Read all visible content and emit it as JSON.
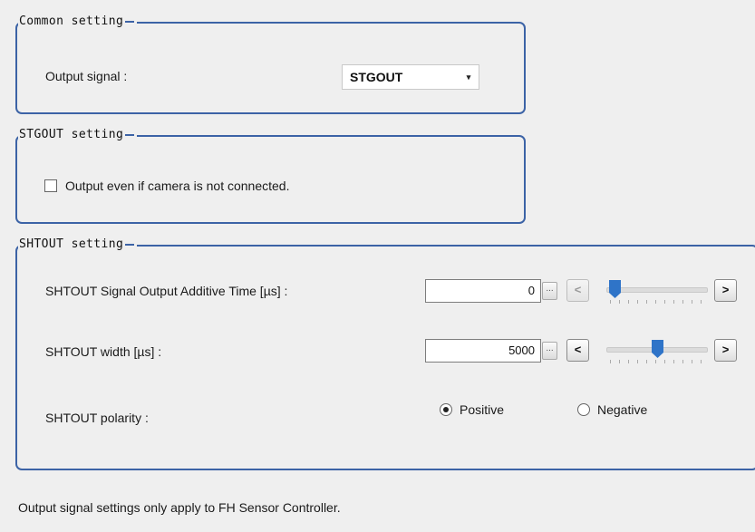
{
  "common_group": {
    "title": "Common setting",
    "output_signal_label": "Output signal :",
    "output_signal_value": "STGOUT",
    "dropdown_arrow": "▾"
  },
  "stgout_group": {
    "title": "STGOUT setting",
    "checkbox_label": "Output even if camera is not connected.",
    "checkbox_checked": false
  },
  "shtout_group": {
    "title": "SHTOUT setting",
    "additive_time": {
      "label": "SHTOUT Signal Output Additive Time [µs] :",
      "value": "0",
      "slider_fraction": 0.03,
      "decrement_enabled": false
    },
    "width": {
      "label": "SHTOUT width [µs] :",
      "value": "5000",
      "slider_fraction": 0.5,
      "decrement_enabled": true
    },
    "polarity": {
      "label": "SHTOUT polarity :",
      "options": [
        "Positive",
        "Negative"
      ],
      "selected": "Positive"
    },
    "ellipsis_label": "...",
    "decrement_label": "<",
    "increment_label": ">"
  },
  "footer_note": "Output signal settings only apply to FH Sensor Controller.",
  "colors": {
    "group_border": "#3c63a6",
    "slider_thumb": "#2f74c8",
    "background": "#efefef"
  }
}
